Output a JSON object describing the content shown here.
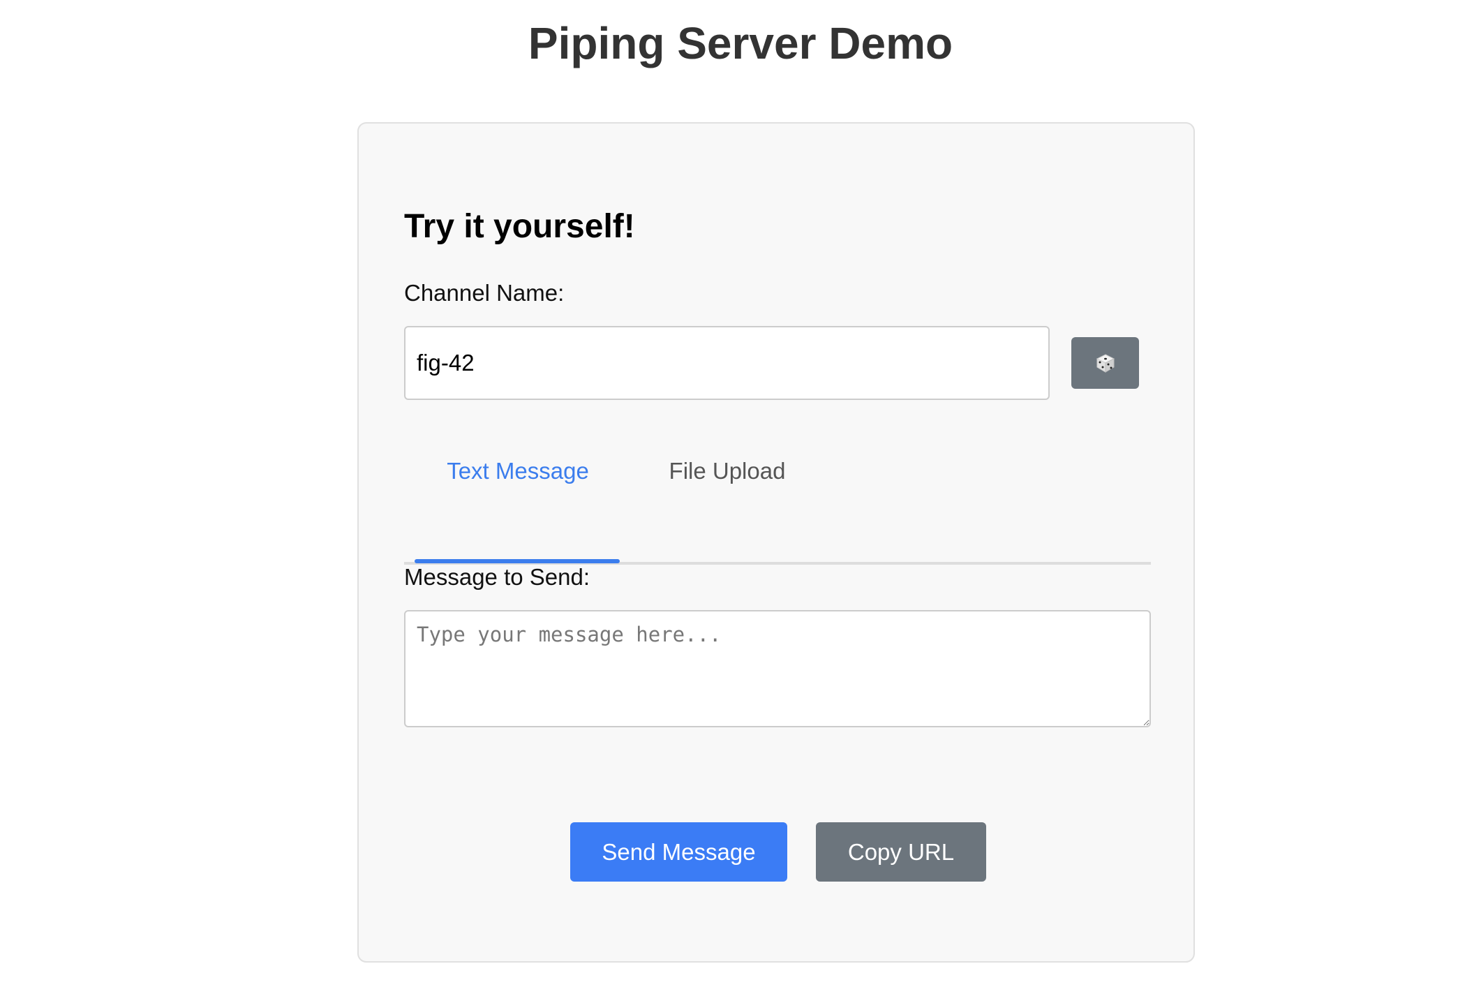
{
  "page": {
    "title": "Piping Server Demo"
  },
  "card": {
    "title": "Try it yourself!",
    "channel": {
      "label": "Channel Name:",
      "value": "fig-42",
      "random_icon": "dice-icon"
    },
    "tabs": [
      {
        "label": "Text Message",
        "active": true
      },
      {
        "label": "File Upload",
        "active": false
      }
    ],
    "message": {
      "label": "Message to Send:",
      "value": "",
      "placeholder": "Type your message here..."
    },
    "actions": {
      "send_label": "Send Message",
      "copy_label": "Copy URL"
    }
  },
  "colors": {
    "accent": "#3b7cf5",
    "secondary": "#6c757d",
    "card_background": "#f8f8f8",
    "title_text": "#333333"
  }
}
